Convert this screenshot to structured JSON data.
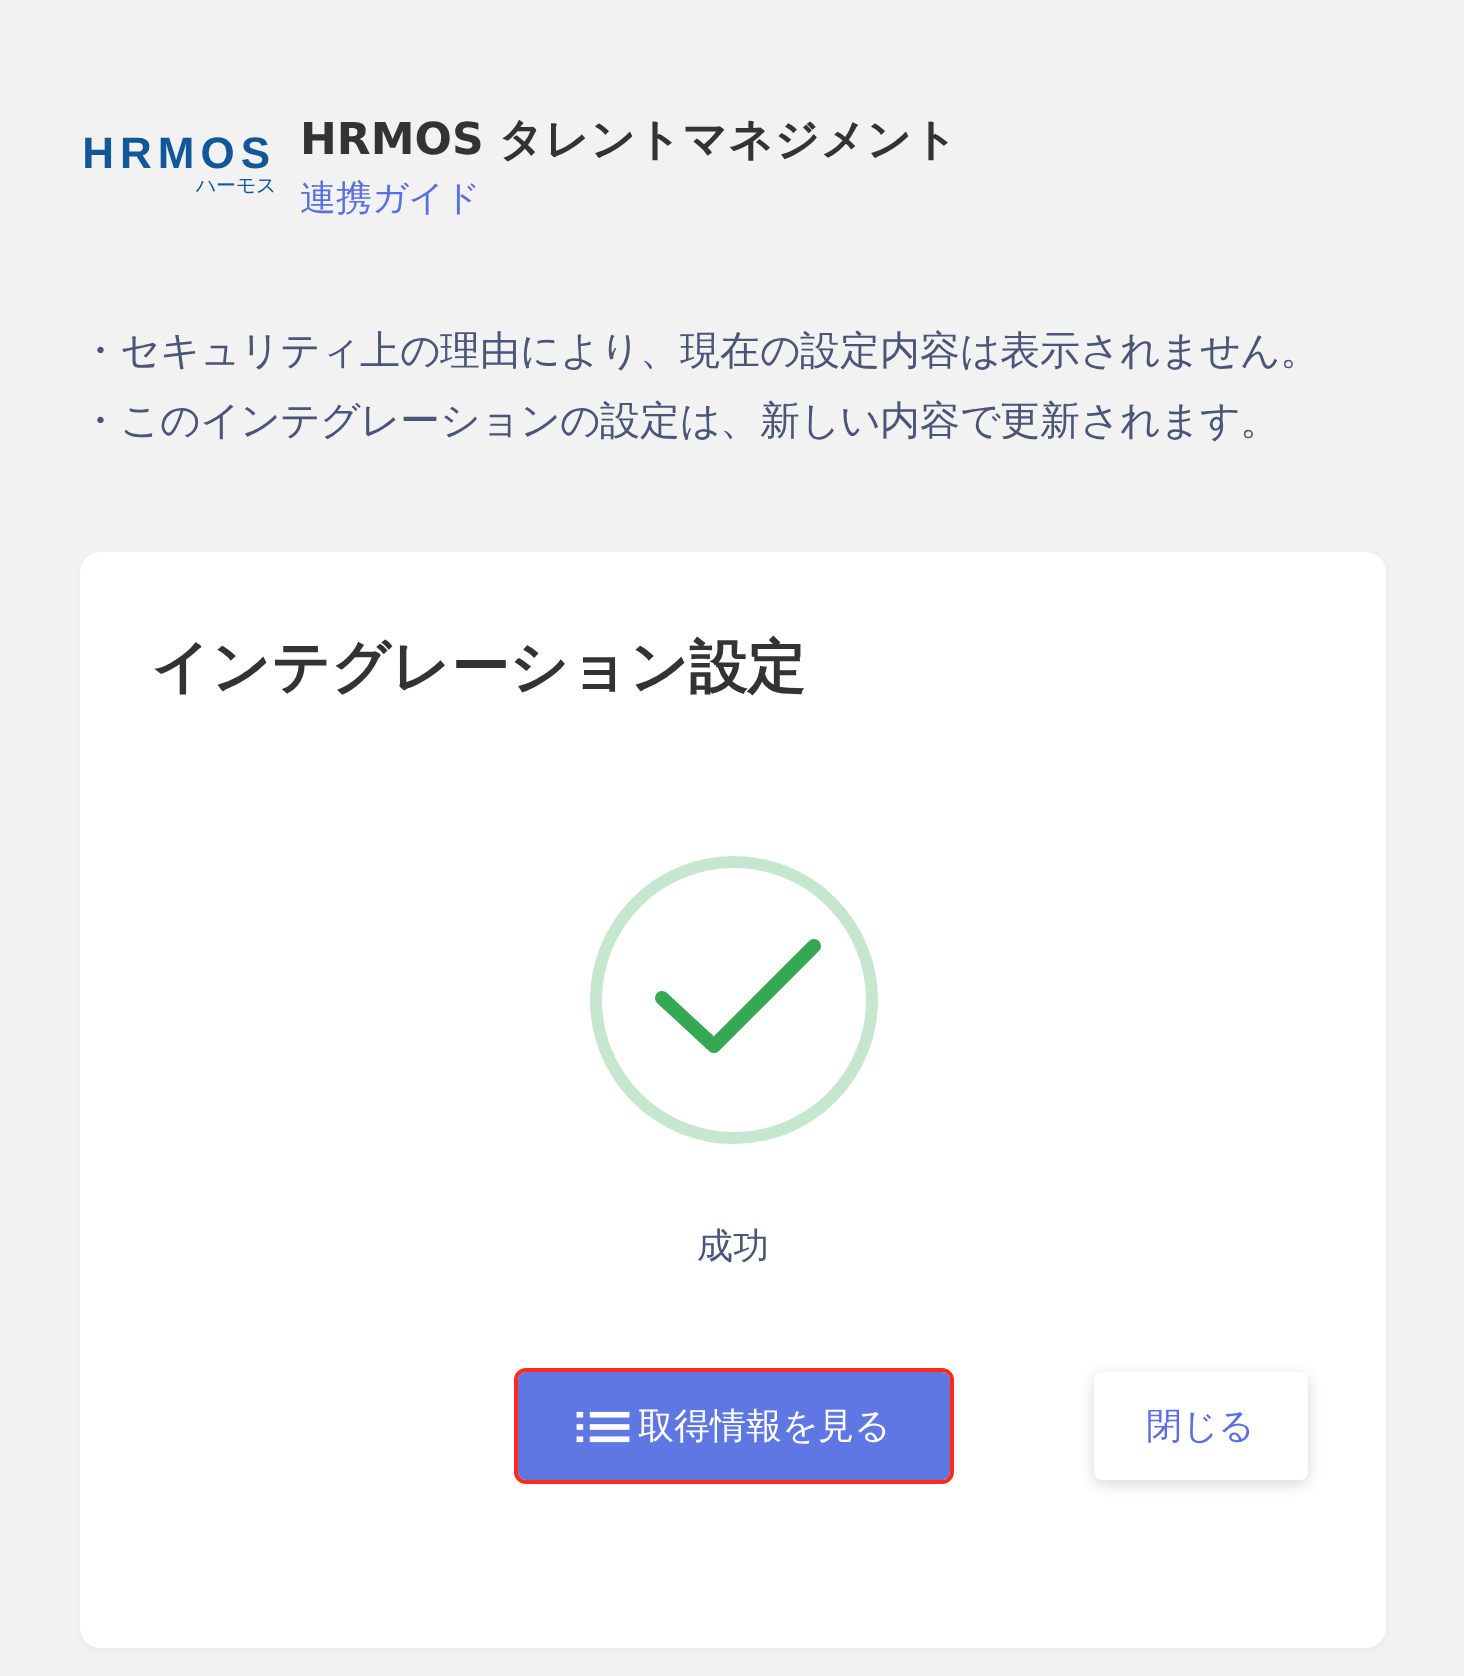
{
  "header": {
    "logo": {
      "wordmark": "HRMOS",
      "kana": "ハーモス"
    },
    "title": "HRMOS タレントマネジメント",
    "guide_link": "連携ガイド"
  },
  "notices": [
    "・セキュリティ上の理由により、現在の設定内容は表示されません。",
    "・このインテグレーションの設定は、新しい内容で更新されます。"
  ],
  "card": {
    "title": "インテグレーション設定",
    "status": {
      "kind": "success",
      "label": "成功"
    },
    "buttons": [
      {
        "kind": "primary",
        "label": "取得情報を見る",
        "focused": true
      },
      {
        "kind": "secondary",
        "label": "閉じる",
        "focused": false
      }
    ]
  }
}
